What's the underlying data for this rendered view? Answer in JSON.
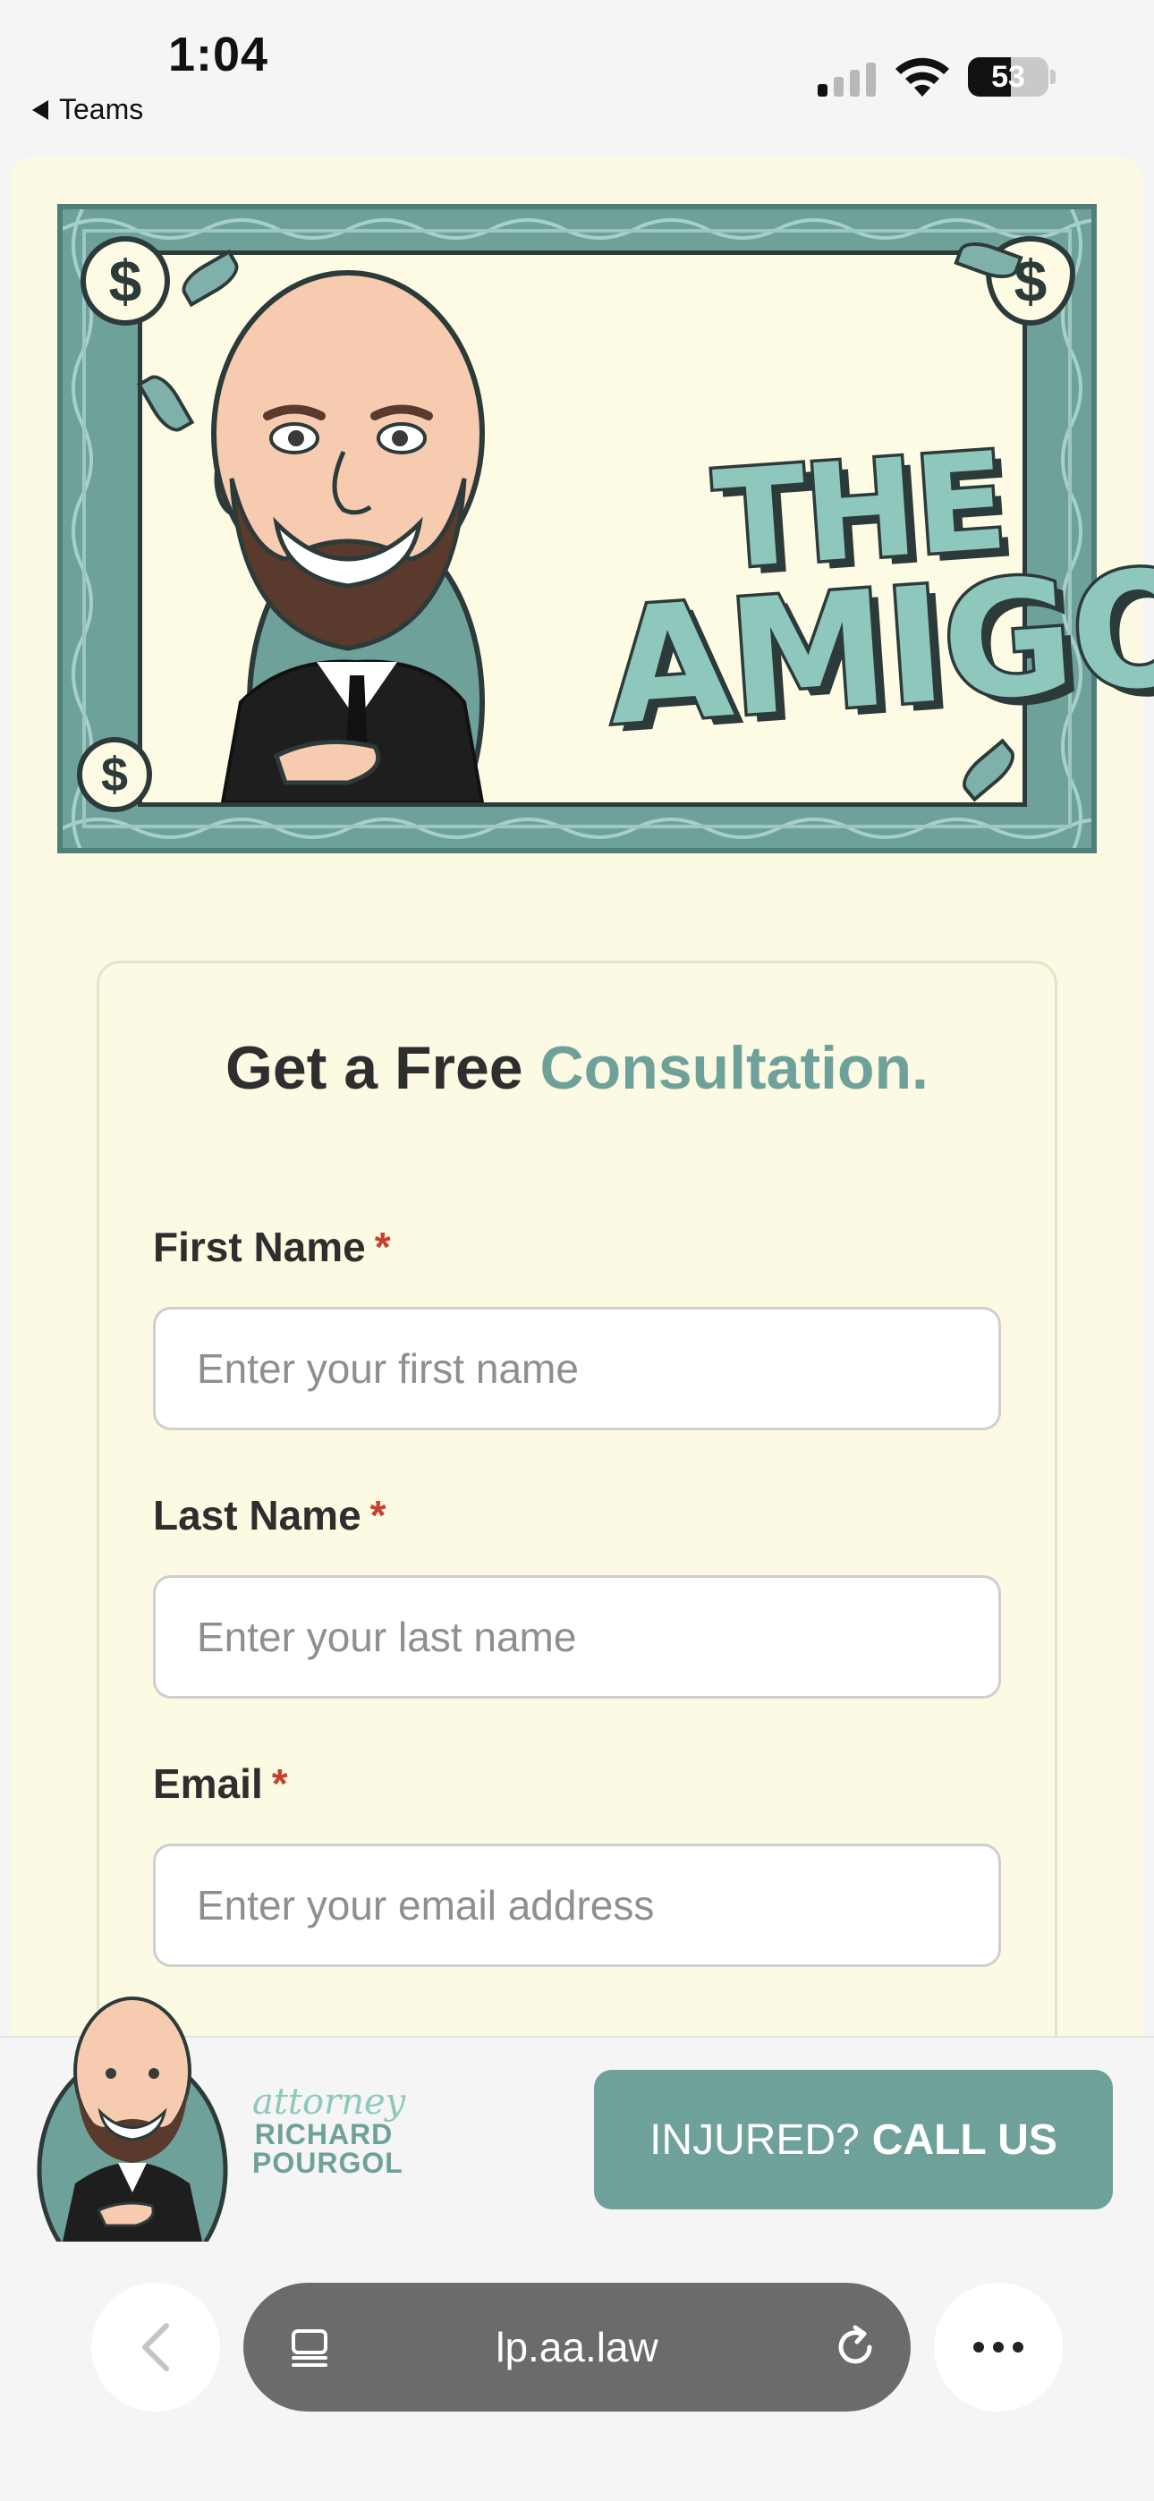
{
  "status_bar": {
    "time": "1:04",
    "back_app": "Teams",
    "battery_level": "53",
    "signal_bars_on": 1
  },
  "banner": {
    "title_line1": "THE",
    "title_line2": "AMIGO",
    "coin_symbol": "$"
  },
  "consultation": {
    "title_plain": "Get a Free",
    "title_accent": "Consultation.",
    "required_marker": "*",
    "fields": [
      {
        "label": "First Name",
        "placeholder": "Enter your first name"
      },
      {
        "label": "Last Name",
        "placeholder": "Enter your last name"
      },
      {
        "label": "Email",
        "placeholder": "Enter your email address"
      }
    ]
  },
  "footer": {
    "logo_script": "attorney",
    "logo_line1": "RICHARD",
    "logo_line2": "POURGOL",
    "call_prefix": "INJURED?",
    "call_bold": "CALL US"
  },
  "browser": {
    "url": "lp.aa.law"
  },
  "colors": {
    "accent": "#6fa19b",
    "page_background": "#fcfae3",
    "required": "#c8402f"
  }
}
